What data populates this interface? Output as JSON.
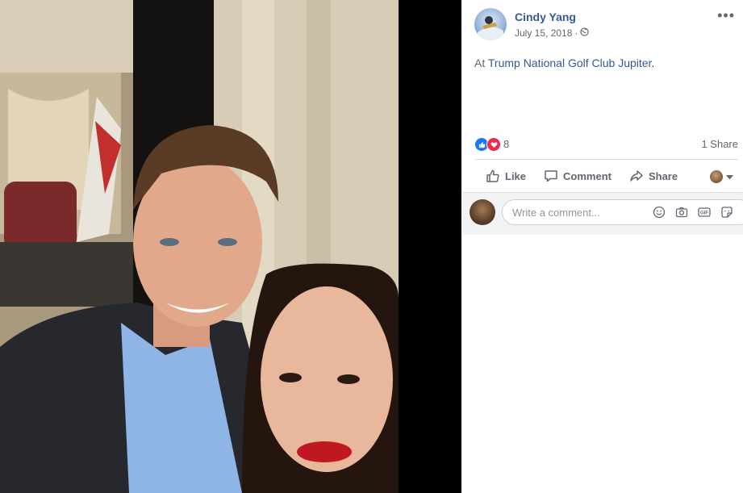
{
  "post": {
    "author": "Cindy Yang",
    "date": "July 15, 2018",
    "date_separator": "·",
    "more_label": "•••",
    "caption_prefix": "At ",
    "place": "Trump National Golf Club Jupiter",
    "caption_suffix": "."
  },
  "reactions": {
    "count": "8",
    "shares": "1 Share",
    "icons": [
      "like-icon",
      "love-icon"
    ]
  },
  "actions": {
    "like": "Like",
    "comment": "Comment",
    "share": "Share"
  },
  "comment": {
    "placeholder": "Write a comment..."
  },
  "colors": {
    "link": "#365899",
    "muted": "#606770",
    "like_blue": "#1877f2",
    "love_red": "#f0284a"
  }
}
